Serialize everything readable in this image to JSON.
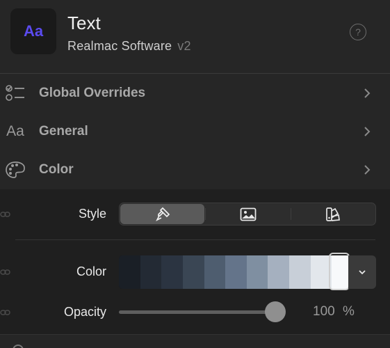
{
  "header": {
    "icon_text": "Aa",
    "title": "Text",
    "vendor": "Realmac Software",
    "version": "v2",
    "help_glyph": "?"
  },
  "sections": [
    {
      "label": "Global Overrides",
      "icon": "list-check-icon"
    },
    {
      "label": "General",
      "icon": "text-aa-icon",
      "icon_text": "Aa"
    },
    {
      "label": "Color",
      "icon": "palette-icon"
    }
  ],
  "color_panel": {
    "style_label": "Style",
    "style_options": [
      {
        "name": "brush-icon",
        "active": true
      },
      {
        "name": "image-icon",
        "active": false
      },
      {
        "name": "swatches-icon",
        "active": false
      }
    ],
    "color_label": "Color",
    "palette": [
      "#1a1f26",
      "#232a34",
      "#2b3441",
      "#3a4654",
      "#4e5d6f",
      "#64748a",
      "#7f8fa1",
      "#a5b0bf",
      "#c8cfd8",
      "#e3e7ec",
      "#f8f9fb"
    ],
    "selected_swatch_index": 10,
    "opacity_label": "Opacity",
    "opacity_value": "100",
    "opacity_unit": "%",
    "opacity_fraction": 1.0
  },
  "colors": {
    "accent": "#5b4bf0",
    "background": "#262626",
    "panel": "#1f1f1f"
  }
}
